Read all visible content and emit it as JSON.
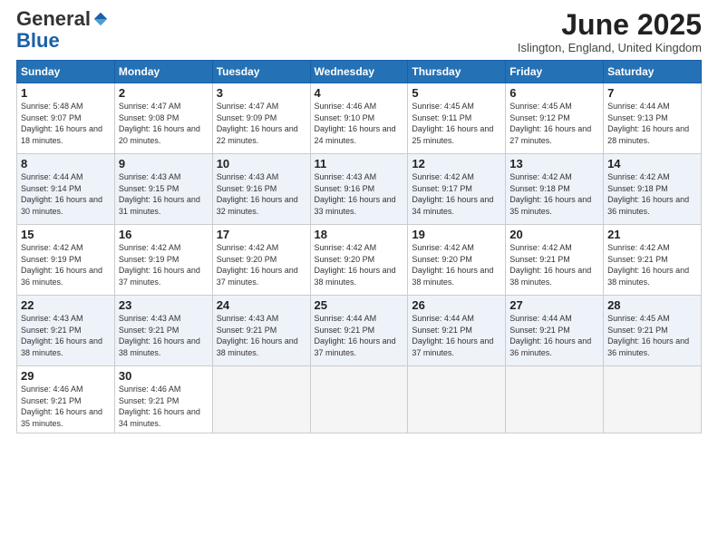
{
  "header": {
    "logo_general": "General",
    "logo_blue": "Blue",
    "month_title": "June 2025",
    "subtitle": "Islington, England, United Kingdom"
  },
  "calendar": {
    "days_of_week": [
      "Sunday",
      "Monday",
      "Tuesday",
      "Wednesday",
      "Thursday",
      "Friday",
      "Saturday"
    ],
    "weeks": [
      [
        {
          "day": "1",
          "sunrise": "5:48 AM",
          "sunset": "9:07 PM",
          "daylight": "16 hours and 18 minutes."
        },
        {
          "day": "2",
          "sunrise": "4:47 AM",
          "sunset": "9:08 PM",
          "daylight": "16 hours and 20 minutes."
        },
        {
          "day": "3",
          "sunrise": "4:47 AM",
          "sunset": "9:09 PM",
          "daylight": "16 hours and 22 minutes."
        },
        {
          "day": "4",
          "sunrise": "4:46 AM",
          "sunset": "9:10 PM",
          "daylight": "16 hours and 24 minutes."
        },
        {
          "day": "5",
          "sunrise": "4:45 AM",
          "sunset": "9:11 PM",
          "daylight": "16 hours and 25 minutes."
        },
        {
          "day": "6",
          "sunrise": "4:45 AM",
          "sunset": "9:12 PM",
          "daylight": "16 hours and 27 minutes."
        },
        {
          "day": "7",
          "sunrise": "4:44 AM",
          "sunset": "9:13 PM",
          "daylight": "16 hours and 28 minutes."
        }
      ],
      [
        {
          "day": "8",
          "sunrise": "4:44 AM",
          "sunset": "9:14 PM",
          "daylight": "16 hours and 30 minutes."
        },
        {
          "day": "9",
          "sunrise": "4:43 AM",
          "sunset": "9:15 PM",
          "daylight": "16 hours and 31 minutes."
        },
        {
          "day": "10",
          "sunrise": "4:43 AM",
          "sunset": "9:16 PM",
          "daylight": "16 hours and 32 minutes."
        },
        {
          "day": "11",
          "sunrise": "4:43 AM",
          "sunset": "9:16 PM",
          "daylight": "16 hours and 33 minutes."
        },
        {
          "day": "12",
          "sunrise": "4:42 AM",
          "sunset": "9:17 PM",
          "daylight": "16 hours and 34 minutes."
        },
        {
          "day": "13",
          "sunrise": "4:42 AM",
          "sunset": "9:18 PM",
          "daylight": "16 hours and 35 minutes."
        },
        {
          "day": "14",
          "sunrise": "4:42 AM",
          "sunset": "9:18 PM",
          "daylight": "16 hours and 36 minutes."
        }
      ],
      [
        {
          "day": "15",
          "sunrise": "4:42 AM",
          "sunset": "9:19 PM",
          "daylight": "16 hours and 36 minutes."
        },
        {
          "day": "16",
          "sunrise": "4:42 AM",
          "sunset": "9:19 PM",
          "daylight": "16 hours and 37 minutes."
        },
        {
          "day": "17",
          "sunrise": "4:42 AM",
          "sunset": "9:20 PM",
          "daylight": "16 hours and 37 minutes."
        },
        {
          "day": "18",
          "sunrise": "4:42 AM",
          "sunset": "9:20 PM",
          "daylight": "16 hours and 38 minutes."
        },
        {
          "day": "19",
          "sunrise": "4:42 AM",
          "sunset": "9:20 PM",
          "daylight": "16 hours and 38 minutes."
        },
        {
          "day": "20",
          "sunrise": "4:42 AM",
          "sunset": "9:21 PM",
          "daylight": "16 hours and 38 minutes."
        },
        {
          "day": "21",
          "sunrise": "4:42 AM",
          "sunset": "9:21 PM",
          "daylight": "16 hours and 38 minutes."
        }
      ],
      [
        {
          "day": "22",
          "sunrise": "4:43 AM",
          "sunset": "9:21 PM",
          "daylight": "16 hours and 38 minutes."
        },
        {
          "day": "23",
          "sunrise": "4:43 AM",
          "sunset": "9:21 PM",
          "daylight": "16 hours and 38 minutes."
        },
        {
          "day": "24",
          "sunrise": "4:43 AM",
          "sunset": "9:21 PM",
          "daylight": "16 hours and 38 minutes."
        },
        {
          "day": "25",
          "sunrise": "4:44 AM",
          "sunset": "9:21 PM",
          "daylight": "16 hours and 37 minutes."
        },
        {
          "day": "26",
          "sunrise": "4:44 AM",
          "sunset": "9:21 PM",
          "daylight": "16 hours and 37 minutes."
        },
        {
          "day": "27",
          "sunrise": "4:44 AM",
          "sunset": "9:21 PM",
          "daylight": "16 hours and 36 minutes."
        },
        {
          "day": "28",
          "sunrise": "4:45 AM",
          "sunset": "9:21 PM",
          "daylight": "16 hours and 36 minutes."
        }
      ],
      [
        {
          "day": "29",
          "sunrise": "4:46 AM",
          "sunset": "9:21 PM",
          "daylight": "16 hours and 35 minutes."
        },
        {
          "day": "30",
          "sunrise": "4:46 AM",
          "sunset": "9:21 PM",
          "daylight": "16 hours and 34 minutes."
        },
        null,
        null,
        null,
        null,
        null
      ]
    ]
  }
}
